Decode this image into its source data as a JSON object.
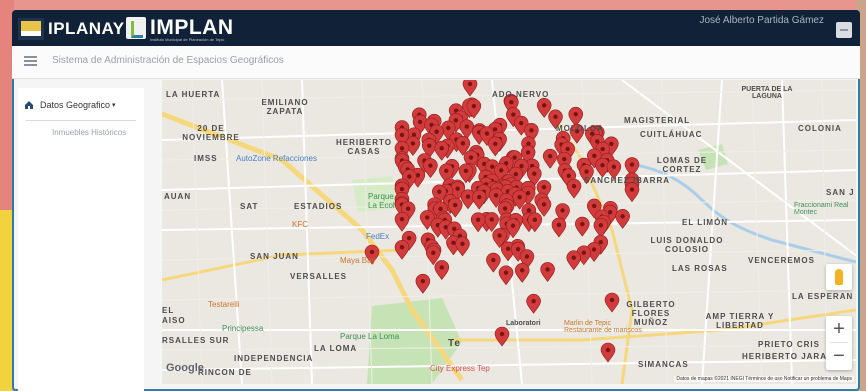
{
  "header": {
    "brand_left": "IPLANAY",
    "brand_right": "IMPLAN",
    "brand_sub": "Instituto Municipal de Planeación de Tepic",
    "logo_mark_text": "IPLANAY",
    "user_name": "José Alberto Partida Gámez"
  },
  "toolbar": {
    "system_title": "Sistema de Administración de Espacios Geográficos"
  },
  "sidebar": {
    "group_label": "Datos Geografico",
    "items": [
      {
        "label": "Inmuebles Históricos"
      }
    ]
  },
  "map": {
    "labels": {
      "la_huerta": "LA HUERTA",
      "emiliano_zapata": "EMILIANO ZAPATA",
      "veinte_noviembre": "20 DE NOVIEMBRE",
      "imss": "IMSS",
      "autozone": "AutoZone Refacciones",
      "heriberto_casas": "HERIBERTO CASAS",
      "prado_nervo": "ADO NERVO",
      "mololoa": "MOLOLOA",
      "magisterial": "MAGISTERIAL",
      "cuitlahuac": "CUITLÁHUAC",
      "puerta_laguna": "PUERTA DE LA LAGUNA",
      "colonia": "COLONIA",
      "lomas_cortez": "LOMAS DE CORTEZ",
      "sanchez_ibarra": "SANCHEZ IBARRA",
      "sat": "SAT",
      "estadios": "ESTADIOS",
      "kfc": "KFC",
      "fedex": "FedEx",
      "parque_ecol": "Parque La Ecol",
      "el_limon": "EL LIMÓN",
      "luis_donaldo": "LUIS DONALDO COLOSIO",
      "san_juan": "SAN JUAN",
      "san_j": "SAN J",
      "fraccionamiento": "Fraccionami Real Montec",
      "maya_bay": "Maya Bay",
      "versalles": "VERSALLES",
      "las_rosas": "LAS ROSAS",
      "venceremos": "VENCEREMOS",
      "auan": "AUAN",
      "testarelli": "Testarelli",
      "la_esperanza": "LA ESPERAN",
      "gilberto_flores": "GILBERTO FLORES MUÑOZ",
      "laboratorios": "Laboratori",
      "marlin": "Marlin de Tepic Restaurante de mariscos",
      "amp_tierra": "AMP TIERRA Y LIBERTAD",
      "prieto_cris": "PRIETO CRIS",
      "heriberto_jara": "HERIBERTO JARA",
      "simancas": "SIMANCAS",
      "principessa": "Principessa",
      "parque_loma": "Parque La Loma",
      "versalles_sur": "RSALLES SUR",
      "aiso": "AISO",
      "el_2": "EL",
      "la_loma": "LA LOMA",
      "independencia": "INDEPENDENCIA",
      "city_express": "City Express Tep",
      "rincon": "RINCON DE",
      "tepic": "Te"
    },
    "google_logo": "Google",
    "footer": "Datos de mapas ©2021 INEGI   Términos de uso   Notificar un problema de Maps",
    "zoom_in": "+",
    "zoom_out": "−",
    "marker_color": "#d23b3b",
    "marker_count": 190
  },
  "colors": {
    "header_bg": "#112238",
    "accent_green": "#7fbf3f",
    "accent_blue": "#2a7ea8"
  }
}
